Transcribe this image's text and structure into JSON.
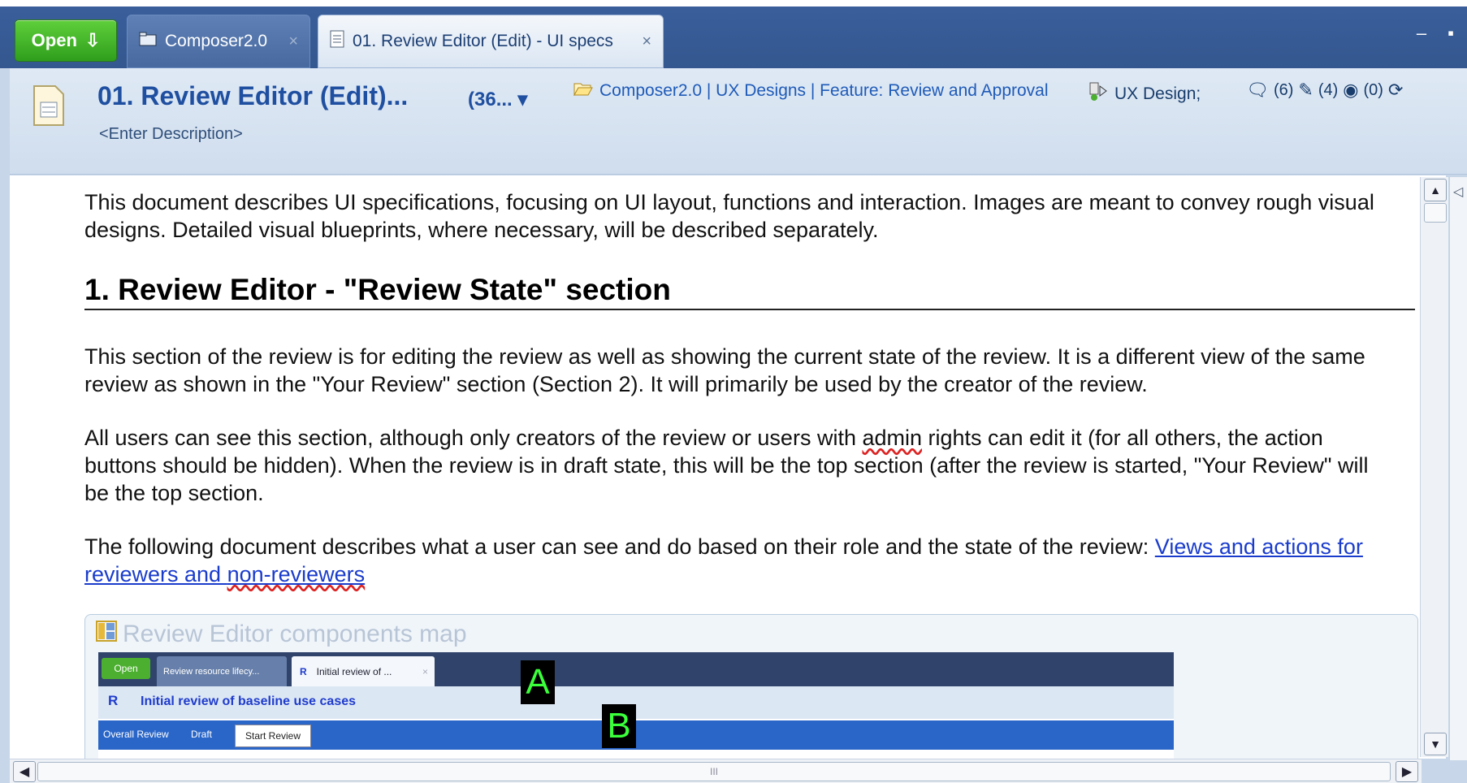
{
  "tabbar": {
    "open_label": "Open",
    "tabs": [
      {
        "label": "Composer2.0",
        "close": "×"
      },
      {
        "label": "01. Review Editor (Edit) - UI specs",
        "close": "×"
      }
    ],
    "window_controls": "– ▪"
  },
  "header": {
    "title": "01. Review Editor (Edit)...",
    "title_extra": "(36...",
    "description": "<Enter Description>",
    "breadcrumb": "Composer2.0 | UX Designs | Feature: Review and Approval",
    "type": "UX Design;",
    "counts": {
      "comments": "(6)",
      "approvals": "(4)",
      "subscribers": "(0)"
    }
  },
  "document": {
    "intro": "This document describes UI specifications, focusing on UI layout, functions and interaction.  Images are meant to convey rough visual designs.  Detailed visual blueprints, where necessary, will be described separately.",
    "heading": "1.  Review Editor - \"Review State\" section",
    "p1": "This section of the review is for editing the review as well as showing the current state of the review.  It is a different view of the same review as shown in the \"Your Review\" section (Section 2).  It will primarily be used by the creator of the review.",
    "p2_a": "All users can see this section, although only creators of the review or users with ",
    "p2_squiggle": "admin",
    "p2_b": " rights can edit it (for all others, the action buttons should be hidden).  When the review is in draft state, this will be the top section (after the review is started, \"Your Review\" will be the top section.",
    "p3_a": "The following document describes what a user can see and do based on their role and the state of the review: ",
    "p3_link_a": "Views and actions for reviewers and ",
    "p3_link_b": "non-reviewers",
    "panel_title": "Review Editor components map",
    "shot": {
      "open": "Open",
      "tab1": "Review resource lifecy...",
      "tab2_prefix": "R",
      "tab2": "Initial review of ...",
      "tab2_close": "×",
      "header_prefix": "R",
      "header_title": "Initial review of baseline use cases",
      "overall": "Overall Review",
      "draft": "Draft",
      "start_button": "Start Review",
      "marker_a": "A",
      "marker_b": "B"
    }
  },
  "scroll": {
    "hthumb_grip": "III"
  }
}
